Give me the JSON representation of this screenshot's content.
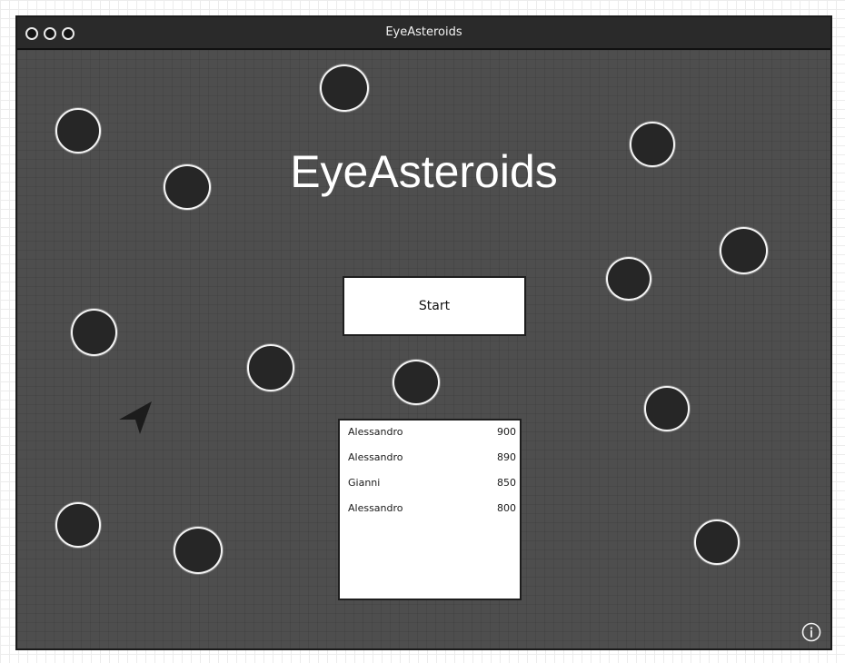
{
  "window": {
    "title": "EyeAsteroids"
  },
  "game": {
    "title": "EyeAsteroids",
    "start_label": "Start"
  },
  "leaderboard": {
    "rows": [
      {
        "name": "Alessandro",
        "score": "900"
      },
      {
        "name": "Alessandro",
        "score": "890"
      },
      {
        "name": "Gianni",
        "score": "850"
      },
      {
        "name": "Alessandro",
        "score": "800"
      }
    ]
  },
  "icons": {
    "info": "info-icon",
    "ship": "ship-icon",
    "window_buttons": [
      "window-close-icon",
      "window-minimize-icon",
      "window-maximize-icon"
    ]
  },
  "colors": {
    "canvas": "#4e4e4e",
    "asteroid": "#262626",
    "asteroid_outline": "#f4f4f4",
    "titlebar": "#2a2a2a"
  }
}
